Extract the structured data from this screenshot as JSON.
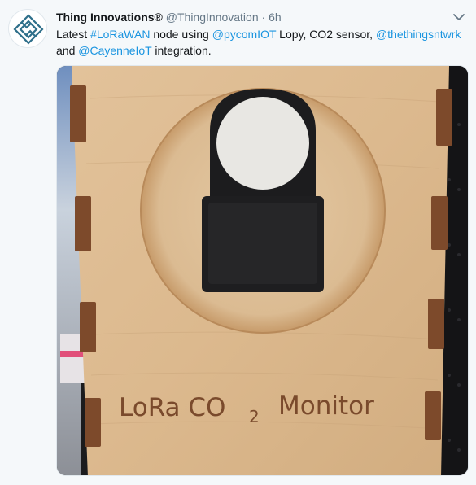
{
  "tweet": {
    "author_name": "Thing Innovations®",
    "author_handle": "@ThingInnovation",
    "separator": "·",
    "timestamp": "6h",
    "text_parts": [
      {
        "text": "Latest ",
        "type": "plain"
      },
      {
        "text": "#LoRaWAN",
        "type": "link"
      },
      {
        "text": " node using ",
        "type": "plain"
      },
      {
        "text": "@pycomIOT",
        "type": "link"
      },
      {
        "text": " Lopy, CO2 sensor, ",
        "type": "plain"
      },
      {
        "text": "@thethingsntwrk",
        "type": "link"
      },
      {
        "text": " and ",
        "type": "plain"
      },
      {
        "text": "@CayenneIoT",
        "type": "link"
      },
      {
        "text": " integration.",
        "type": "plain"
      }
    ],
    "photo": {
      "engraving_text_a": "LoRa CO",
      "engraving_subscript": "2",
      "engraving_text_b": "Monitor"
    },
    "icons": {
      "avatar": "thing-innovations-logo-icon",
      "menu": "chevron-down-icon"
    },
    "colors": {
      "link": "#1b95e0",
      "muted": "#657786",
      "background": "#f5f8fa",
      "logo": "#2e6f8a"
    }
  }
}
